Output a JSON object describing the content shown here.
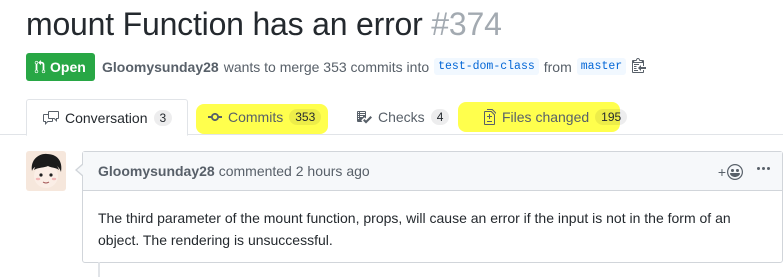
{
  "pr": {
    "title": "mount Function has an error",
    "number": "#374",
    "state_label": "Open",
    "author": "Gloomysunday28",
    "meta_middle": "wants to merge 353 commits into",
    "base_branch": "test-dom-class",
    "from_word": "from",
    "head_branch": "master"
  },
  "tabs": [
    {
      "label": "Conversation",
      "count": "3"
    },
    {
      "label": "Commits",
      "count": "353"
    },
    {
      "label": "Checks",
      "count": "4"
    },
    {
      "label": "Files changed",
      "count": "195"
    }
  ],
  "comment": {
    "author": "Gloomysunday28",
    "action": "commented 2 hours ago",
    "reaction_label": "+",
    "body": "The third parameter of the mount function, props, will cause an error if the input is not in the form of an object. The rendering is unsuccessful."
  },
  "colors": {
    "open_green": "#28a745",
    "highlight": "#ffff3a",
    "link_blue": "#0366d6"
  }
}
